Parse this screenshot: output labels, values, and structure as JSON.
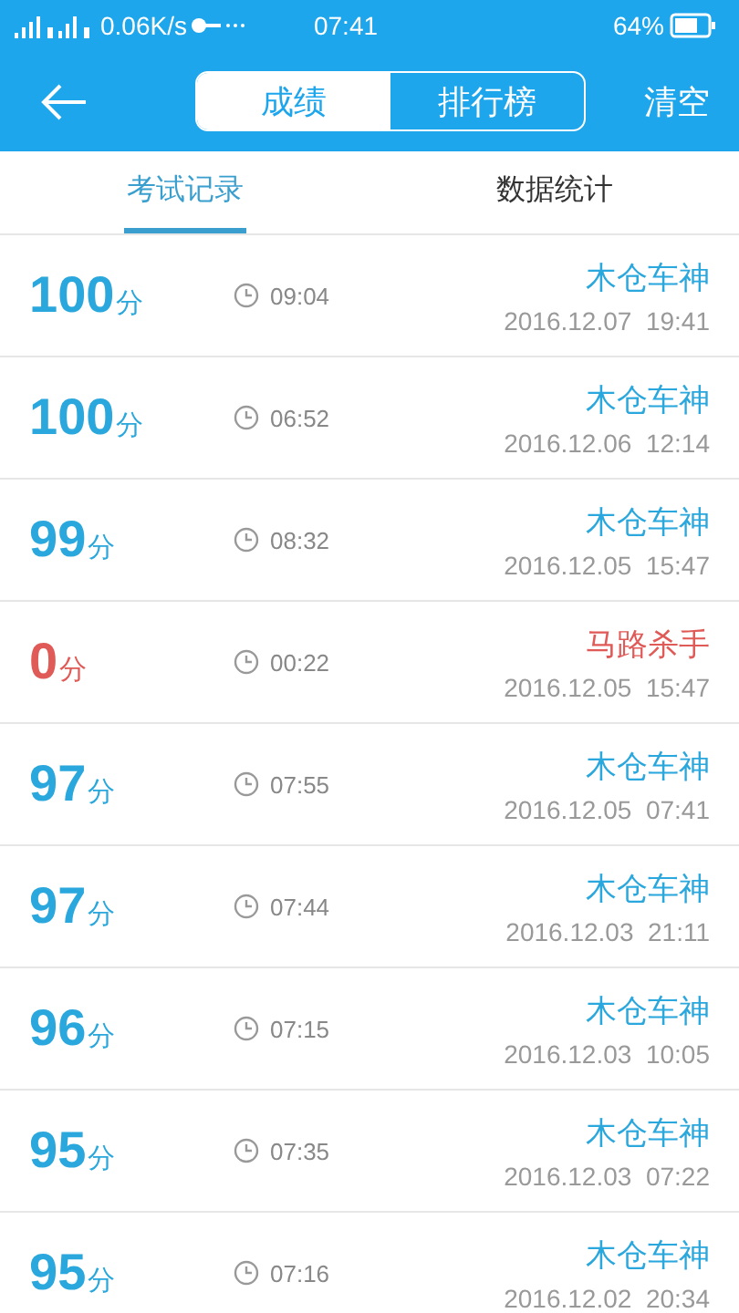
{
  "status_bar": {
    "network_speed": "0.06K/s",
    "time": "07:41",
    "battery": "64%"
  },
  "header": {
    "segments": [
      {
        "label": "成绩",
        "selected": true
      },
      {
        "label": "排行榜",
        "selected": false
      }
    ],
    "action": "清空"
  },
  "tabs": [
    {
      "label": "考试记录",
      "selected": true
    },
    {
      "label": "数据统计",
      "selected": false
    }
  ],
  "records": [
    {
      "score": "100",
      "unit": "分",
      "duration": "09:04",
      "title": "木仓车神",
      "date": "2016.12.07  19:41",
      "color": "#2aa7dc"
    },
    {
      "score": "100",
      "unit": "分",
      "duration": "06:52",
      "title": "木仓车神",
      "date": "2016.12.06  12:14",
      "color": "#2aa7dc"
    },
    {
      "score": "99",
      "unit": "分",
      "duration": "08:32",
      "title": "木仓车神",
      "date": "2016.12.05  15:47",
      "color": "#2aa7dc"
    },
    {
      "score": "0",
      "unit": "分",
      "duration": "00:22",
      "title": "马路杀手",
      "date": "2016.12.05  15:47",
      "color": "#e05a57"
    },
    {
      "score": "97",
      "unit": "分",
      "duration": "07:55",
      "title": "木仓车神",
      "date": "2016.12.05  07:41",
      "color": "#2aa7dc"
    },
    {
      "score": "97",
      "unit": "分",
      "duration": "07:44",
      "title": "木仓车神",
      "date": "2016.12.03  21:11",
      "color": "#2aa7dc"
    },
    {
      "score": "96",
      "unit": "分",
      "duration": "07:15",
      "title": "木仓车神",
      "date": "2016.12.03  10:05",
      "color": "#2aa7dc"
    },
    {
      "score": "95",
      "unit": "分",
      "duration": "07:35",
      "title": "木仓车神",
      "date": "2016.12.03  07:22",
      "color": "#2aa7dc"
    },
    {
      "score": "95",
      "unit": "分",
      "duration": "07:16",
      "title": "木仓车神",
      "date": "2016.12.02  20:34",
      "color": "#2aa7dc"
    }
  ]
}
